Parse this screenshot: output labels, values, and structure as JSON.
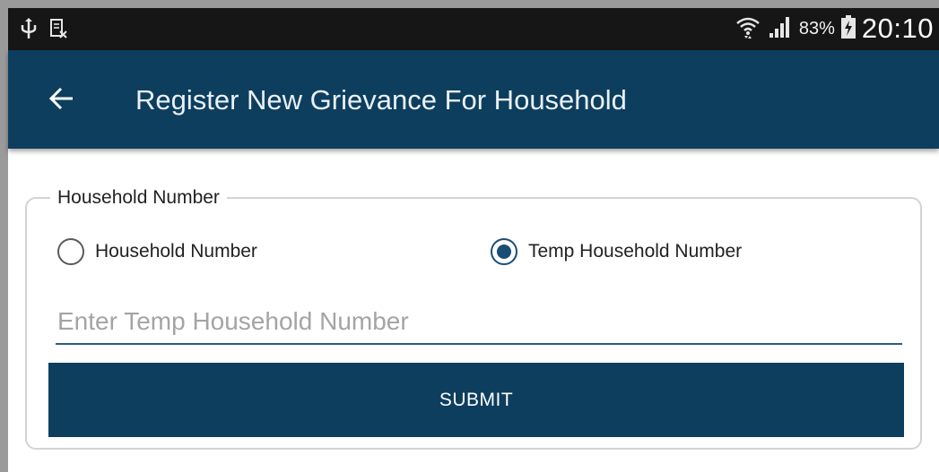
{
  "status_bar": {
    "battery_percent": "83%",
    "time": "20:10",
    "icons": [
      "usb-icon",
      "sim-card-icon",
      "wifi-icon",
      "signal-icon",
      "battery-charging-icon"
    ]
  },
  "app_bar": {
    "title": "Register New Grievance For Household",
    "back_icon": "arrow-left-icon"
  },
  "form": {
    "section_title": "Household Number",
    "options": [
      {
        "label": "Household Number",
        "selected": false
      },
      {
        "label": "Temp Household Number",
        "selected": true
      }
    ],
    "input": {
      "value": "",
      "placeholder": "Enter Temp Household Number"
    },
    "submit_label": "SUBMIT"
  },
  "colors": {
    "primary": "#0d3e5e",
    "status_bar": "#161616",
    "radio_checked": "#1a4d73",
    "border": "#d3d3d3"
  }
}
